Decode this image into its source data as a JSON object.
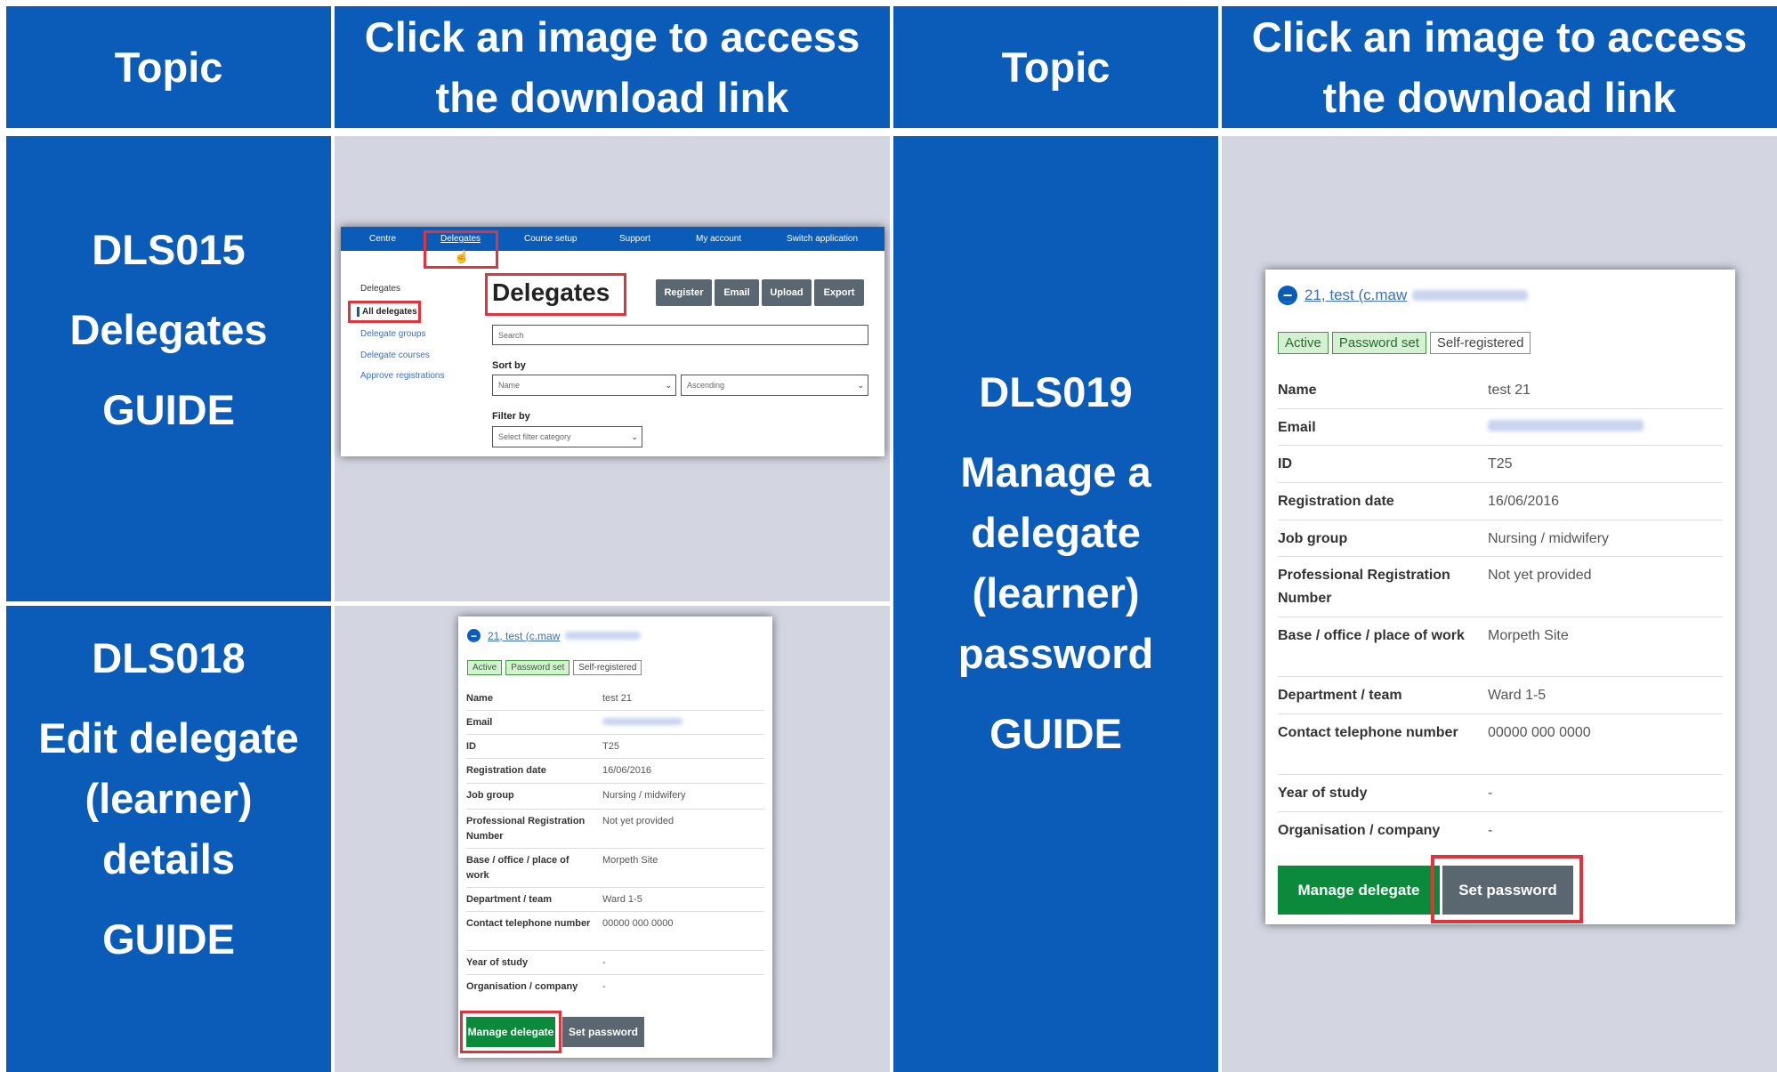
{
  "header": {
    "topic_left": "Topic",
    "click_left_line1": "Click an image to access",
    "click_left_line2": "the download link",
    "topic_right": "Topic",
    "click_right_line1": "Click an image to access",
    "click_right_line2": "the download link"
  },
  "topics": [
    {
      "code": "DLS015",
      "title_lines": [
        "Delegates"
      ],
      "guide": "GUIDE"
    },
    {
      "code": "DLS018",
      "title_lines": [
        "Edit delegate",
        "(learner)",
        "details"
      ],
      "guide": "GUIDE"
    },
    {
      "code": "DLS019",
      "title_lines": [
        "Manage a",
        "delegate",
        "(learner)",
        "password"
      ],
      "guide": "GUIDE"
    }
  ],
  "delegates_screenshot": {
    "nav": [
      "Centre",
      "Delegates",
      "Course setup",
      "Support",
      "My account",
      "Switch application"
    ],
    "side_heading": "Delegates",
    "side_items": [
      "All delegates",
      "Delegate groups",
      "Delegate courses",
      "Approve registrations"
    ],
    "title": "Delegates",
    "buttons": [
      "Register",
      "Email",
      "Upload",
      "Export"
    ],
    "search_placeholder": "Search",
    "sort_label": "Sort by",
    "sort_value": "Name",
    "order_value": "Ascending",
    "filter_label": "Filter by",
    "filter_value": "Select filter category"
  },
  "delegate_card": {
    "header_link": "21, test (c.maw",
    "tags": [
      "Active",
      "Password set",
      "Self-registered"
    ],
    "fields": [
      {
        "label": "Name",
        "value": "test 21"
      },
      {
        "label": "Email",
        "value": ""
      },
      {
        "label": "ID",
        "value": "T25"
      },
      {
        "label": "Registration date",
        "value": "16/06/2016"
      },
      {
        "label": "Job group",
        "value": "Nursing / midwifery"
      },
      {
        "label": "Professional Registration Number",
        "value": "Not yet provided"
      },
      {
        "label": "Base / office / place of work",
        "value": "Morpeth Site"
      },
      {
        "label": "Department / team",
        "value": "Ward 1-5"
      },
      {
        "label": "Contact telephone number",
        "value": "00000 000 0000"
      },
      {
        "label": "Year of study",
        "value": "-"
      },
      {
        "label": "Organisation / company",
        "value": "-"
      }
    ],
    "manage_button": "Manage delegate",
    "password_button": "Set password"
  },
  "colors": {
    "header_blue": "#0b5cb8",
    "image_bg": "#d3d6e1",
    "highlight_red": "#e0333b",
    "green_button": "#0a8a3a"
  }
}
